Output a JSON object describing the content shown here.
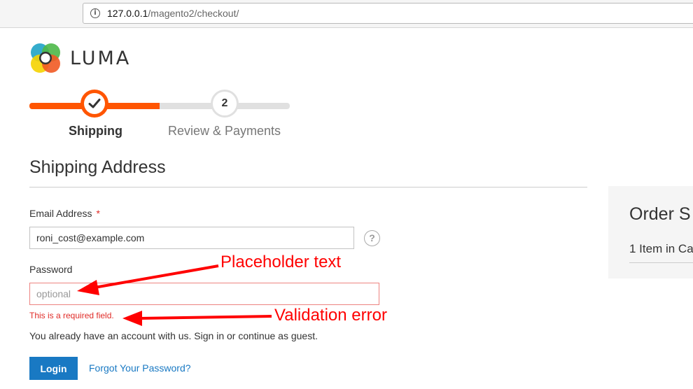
{
  "browser": {
    "url_host": "127.0.0.1",
    "url_path": "/magento2/checkout/"
  },
  "logo": {
    "text": "LUMA"
  },
  "progress": {
    "steps": [
      {
        "label": "Shipping",
        "state": "complete",
        "icon": "checkmark-icon"
      },
      {
        "label": "Review & Payments",
        "number": "2",
        "state": "pending"
      }
    ],
    "accent_color": "#ff5501"
  },
  "shipping": {
    "title": "Shipping Address",
    "email_label": "Email Address",
    "required_marker": "*",
    "email_value": "roni_cost@example.com",
    "help_glyph": "?",
    "password_label": "Password",
    "password_placeholder": "optional",
    "error_text": "This is a required field.",
    "note": "You already have an account with us. Sign in or continue as guest.",
    "login_label": "Login",
    "forgot_link": "Forgot Your Password?"
  },
  "summary": {
    "title": "Order S",
    "items": "1 Item in Ca"
  },
  "annotations": {
    "placeholder": "Placeholder text",
    "validation": "Validation error",
    "color": "#ff0000"
  }
}
